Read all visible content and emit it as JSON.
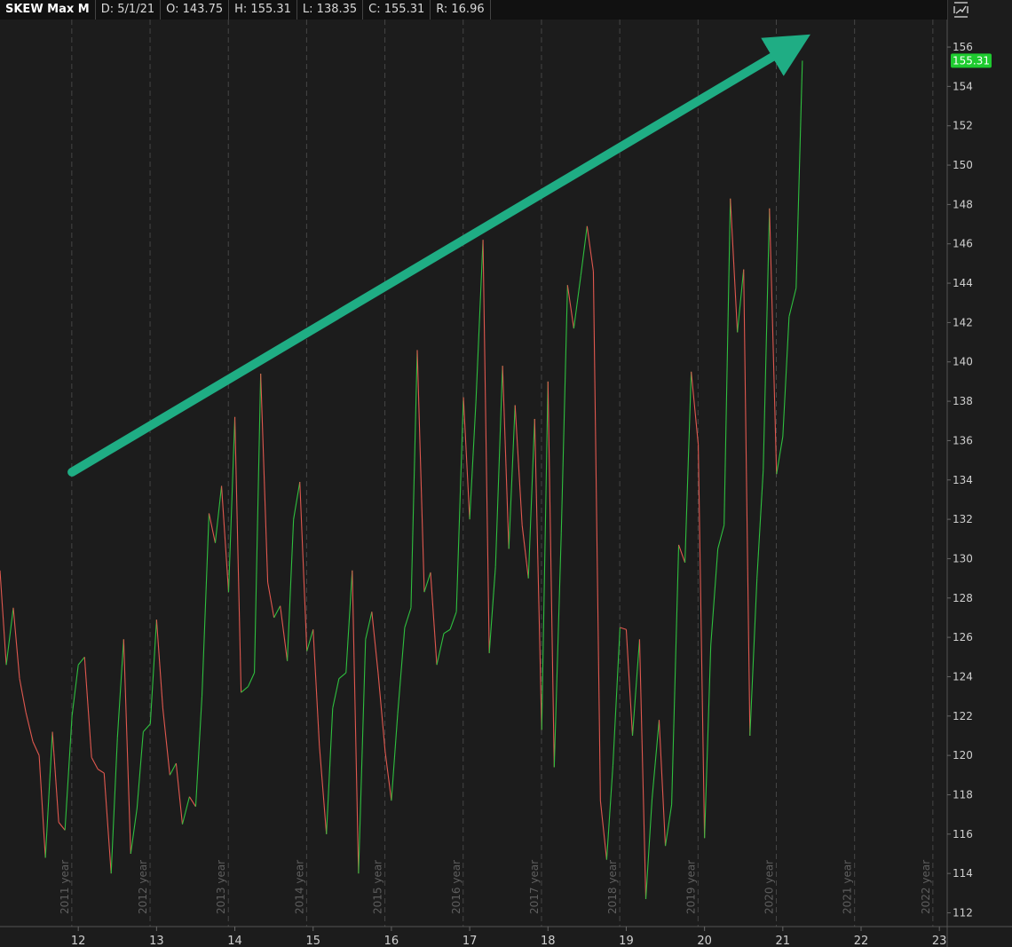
{
  "header": {
    "symbol": "SKEW Max M",
    "date": "D: 5/1/21",
    "open": "O: 143.75",
    "high": "H: 155.31",
    "low": "L: 138.35",
    "close": "C: 155.31",
    "range": "R: 16.96"
  },
  "colors": {
    "background": "#1c1c1c",
    "up": "#2fbf3f",
    "down": "#e0584f",
    "arrow": "#1fad84",
    "grid": "#454545",
    "last_price_badge": "#1ecb2f"
  },
  "chart_data": {
    "type": "line",
    "title": "",
    "xlabel": "",
    "ylabel": "",
    "x_unit": "month",
    "xlim": [
      2011.0,
      2023.1
    ],
    "ylim": [
      111.3,
      157.4
    ],
    "y_ticks": [
      112,
      114,
      116,
      118,
      120,
      122,
      124,
      126,
      128,
      130,
      132,
      134,
      136,
      138,
      140,
      142,
      144,
      146,
      148,
      150,
      152,
      154,
      156
    ],
    "x_ticks": [
      {
        "x": 2012,
        "label": "12"
      },
      {
        "x": 2013,
        "label": "13"
      },
      {
        "x": 2014,
        "label": "14"
      },
      {
        "x": 2015,
        "label": "15"
      },
      {
        "x": 2016,
        "label": "16"
      },
      {
        "x": 2017,
        "label": "17"
      },
      {
        "x": 2018,
        "label": "18"
      },
      {
        "x": 2019,
        "label": "19"
      },
      {
        "x": 2020,
        "label": "20"
      },
      {
        "x": 2021,
        "label": "21"
      },
      {
        "x": 2022,
        "label": "22"
      },
      {
        "x": 2023,
        "label": "23"
      }
    ],
    "year_markers": [
      {
        "x": 2011.917,
        "label": "2011 year"
      },
      {
        "x": 2012.917,
        "label": "2012 year"
      },
      {
        "x": 2013.917,
        "label": "2013 year"
      },
      {
        "x": 2014.917,
        "label": "2014 year"
      },
      {
        "x": 2015.917,
        "label": "2015 year"
      },
      {
        "x": 2016.917,
        "label": "2016 year"
      },
      {
        "x": 2017.917,
        "label": "2017 year"
      },
      {
        "x": 2018.917,
        "label": "2018 year"
      },
      {
        "x": 2019.917,
        "label": "2019 year"
      },
      {
        "x": 2020.917,
        "label": "2020 year"
      },
      {
        "x": 2021.917,
        "label": "2021 year"
      },
      {
        "x": 2022.917,
        "label": "2022 year"
      }
    ],
    "grid": true,
    "series": [
      {
        "values": [
          [
            2011.0,
            129.4
          ],
          [
            2011.08,
            124.6
          ],
          [
            2011.17,
            127.5
          ],
          [
            2011.25,
            123.9
          ],
          [
            2011.33,
            122.2
          ],
          [
            2011.42,
            120.7
          ],
          [
            2011.5,
            120.0
          ],
          [
            2011.58,
            114.8
          ],
          [
            2011.67,
            121.2
          ],
          [
            2011.75,
            116.6
          ],
          [
            2011.83,
            116.2
          ],
          [
            2011.92,
            122.0
          ],
          [
            2012.0,
            124.6
          ],
          [
            2012.08,
            125.0
          ],
          [
            2012.17,
            119.9
          ],
          [
            2012.25,
            119.3
          ],
          [
            2012.33,
            119.1
          ],
          [
            2012.42,
            114.0
          ],
          [
            2012.5,
            120.9
          ],
          [
            2012.58,
            125.9
          ],
          [
            2012.67,
            115.0
          ],
          [
            2012.75,
            117.3
          ],
          [
            2012.83,
            121.2
          ],
          [
            2012.92,
            121.6
          ],
          [
            2013.0,
            126.9
          ],
          [
            2013.08,
            122.4
          ],
          [
            2013.17,
            119.0
          ],
          [
            2013.25,
            119.6
          ],
          [
            2013.33,
            116.5
          ],
          [
            2013.42,
            117.9
          ],
          [
            2013.5,
            117.4
          ],
          [
            2013.58,
            123.0
          ],
          [
            2013.67,
            132.3
          ],
          [
            2013.75,
            130.8
          ],
          [
            2013.83,
            133.7
          ],
          [
            2013.92,
            128.3
          ],
          [
            2014.0,
            137.2
          ],
          [
            2014.08,
            123.2
          ],
          [
            2014.17,
            123.5
          ],
          [
            2014.25,
            124.2
          ],
          [
            2014.33,
            139.4
          ],
          [
            2014.42,
            128.8
          ],
          [
            2014.5,
            127.0
          ],
          [
            2014.58,
            127.6
          ],
          [
            2014.67,
            124.8
          ],
          [
            2014.75,
            132.0
          ],
          [
            2014.83,
            133.9
          ],
          [
            2014.92,
            125.3
          ],
          [
            2015.0,
            126.4
          ],
          [
            2015.08,
            120.5
          ],
          [
            2015.17,
            116.0
          ],
          [
            2015.25,
            122.4
          ],
          [
            2015.33,
            123.9
          ],
          [
            2015.42,
            124.2
          ],
          [
            2015.5,
            129.4
          ],
          [
            2015.58,
            114.0
          ],
          [
            2015.67,
            125.9
          ],
          [
            2015.75,
            127.3
          ],
          [
            2015.83,
            124.2
          ],
          [
            2015.92,
            120.2
          ],
          [
            2016.0,
            117.7
          ],
          [
            2016.08,
            122.1
          ],
          [
            2016.17,
            126.5
          ],
          [
            2016.25,
            127.5
          ],
          [
            2016.33,
            140.6
          ],
          [
            2016.42,
            128.3
          ],
          [
            2016.5,
            129.3
          ],
          [
            2016.58,
            124.6
          ],
          [
            2016.67,
            126.2
          ],
          [
            2016.75,
            126.4
          ],
          [
            2016.83,
            127.3
          ],
          [
            2016.92,
            138.2
          ],
          [
            2017.0,
            132.0
          ],
          [
            2017.08,
            138.0
          ],
          [
            2017.17,
            146.2
          ],
          [
            2017.25,
            125.2
          ],
          [
            2017.33,
            129.6
          ],
          [
            2017.42,
            139.8
          ],
          [
            2017.5,
            130.5
          ],
          [
            2017.58,
            137.8
          ],
          [
            2017.67,
            131.7
          ],
          [
            2017.75,
            129.0
          ],
          [
            2017.83,
            137.1
          ],
          [
            2017.92,
            121.3
          ],
          [
            2018.0,
            139.0
          ],
          [
            2018.08,
            119.4
          ],
          [
            2018.17,
            131.3
          ],
          [
            2018.25,
            143.9
          ],
          [
            2018.33,
            141.7
          ],
          [
            2018.42,
            144.4
          ],
          [
            2018.5,
            146.9
          ],
          [
            2018.58,
            144.6
          ],
          [
            2018.67,
            117.7
          ],
          [
            2018.75,
            114.7
          ],
          [
            2018.83,
            119.5
          ],
          [
            2018.92,
            126.5
          ],
          [
            2019.0,
            126.4
          ],
          [
            2019.08,
            121.0
          ],
          [
            2019.17,
            125.9
          ],
          [
            2019.25,
            112.7
          ],
          [
            2019.33,
            117.8
          ],
          [
            2019.42,
            121.8
          ],
          [
            2019.5,
            115.4
          ],
          [
            2019.58,
            117.5
          ],
          [
            2019.67,
            130.7
          ],
          [
            2019.75,
            129.8
          ],
          [
            2019.83,
            139.5
          ],
          [
            2019.92,
            135.8
          ],
          [
            2020.0,
            115.8
          ],
          [
            2020.08,
            125.6
          ],
          [
            2020.17,
            130.5
          ],
          [
            2020.25,
            131.7
          ],
          [
            2020.33,
            148.3
          ],
          [
            2020.42,
            141.5
          ],
          [
            2020.5,
            144.7
          ],
          [
            2020.58,
            121.0
          ],
          [
            2020.67,
            129.0
          ],
          [
            2020.75,
            134.5
          ],
          [
            2020.83,
            147.8
          ],
          [
            2020.92,
            134.3
          ],
          [
            2021.0,
            136.2
          ],
          [
            2021.08,
            142.3
          ],
          [
            2021.17,
            143.75
          ],
          [
            2021.25,
            155.31
          ]
        ]
      }
    ],
    "annotations": [
      {
        "type": "arrow",
        "from": [
          2011.92,
          134.4
        ],
        "to": [
          2021.08,
          156.0
        ]
      }
    ],
    "last_price": "155.31"
  }
}
